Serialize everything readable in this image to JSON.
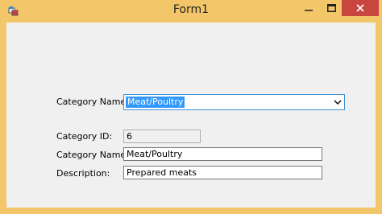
{
  "window": {
    "title": "Form1",
    "icon": "winforms-app-icon",
    "controls": {
      "minimize": "minimize-icon",
      "maximize": "maximize-icon",
      "close": "close-icon"
    }
  },
  "form": {
    "combo_label": "Category Name:",
    "combo_value": "Meat/Poultry",
    "fields": [
      {
        "label": "Category ID:",
        "value": "6"
      },
      {
        "label": "Category Name:",
        "value": "Meat/Poultry"
      },
      {
        "label": "Description:",
        "value": "Prepared meats"
      }
    ]
  },
  "colors": {
    "titlebar": "#f4c66a",
    "close_button": "#c9453f",
    "selection": "#3399ff",
    "focus_border": "#3b8ed6"
  }
}
